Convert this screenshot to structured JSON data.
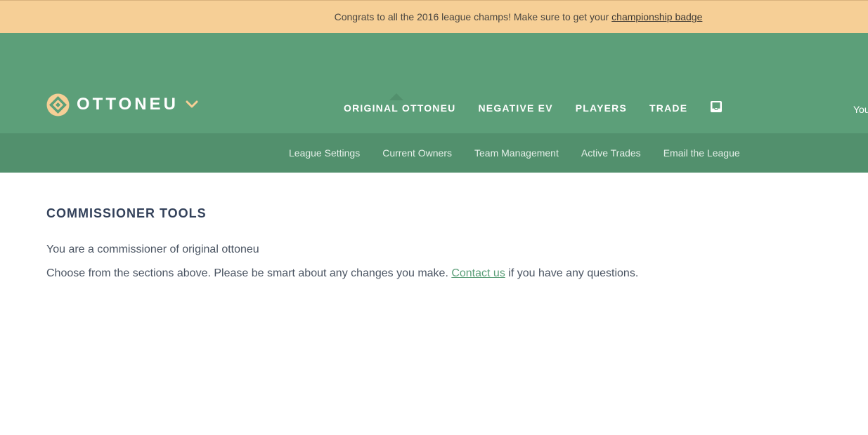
{
  "announcement": {
    "text": "Congrats to all the 2016 league champs! Make sure to get your ",
    "link": "championship badge"
  },
  "brand": {
    "name": "OTTONEU",
    "logo_icon": "ottoneu-diamond-logo-icon",
    "dropdown_icon": "chevron-down-icon",
    "colors": {
      "banner": "#f6cf96",
      "header": "#5c9f79",
      "subnav": "#52906d",
      "logo_accent": "#f6cf96"
    }
  },
  "main_nav": {
    "items": [
      "ORIGINAL OTTONEU",
      "NEGATIVE EV",
      "PLAYERS",
      "TRADE"
    ],
    "inbox_icon": "inbox-icon",
    "user_text": "You"
  },
  "sub_nav": {
    "items": [
      "League Settings",
      "Current Owners",
      "Team Management",
      "Active Trades",
      "Email the League"
    ]
  },
  "content": {
    "title": "COMMISSIONER TOOLS",
    "line1": "You are a commissioner of original ottoneu",
    "line2_before": "Choose from the sections above. Please be smart about any changes you make. ",
    "line2_link": "Contact us",
    "line2_after": " if you have any questions."
  }
}
